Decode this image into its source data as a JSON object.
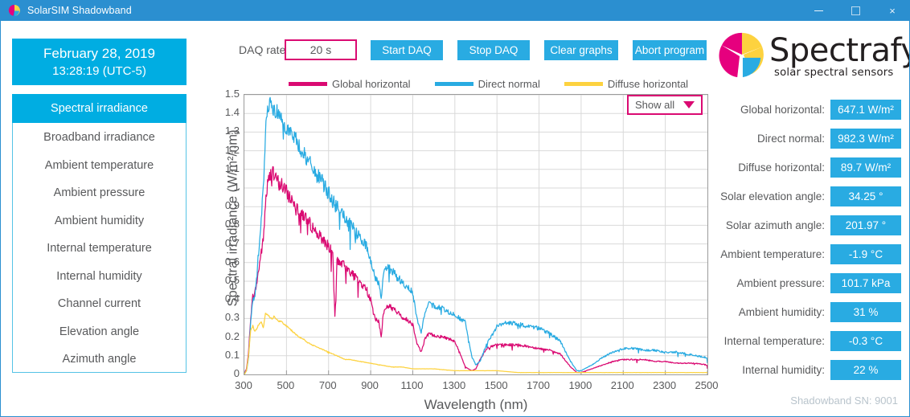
{
  "window": {
    "title": "SolarSIM Shadowband",
    "icon": "app-logo-icon",
    "minimize": "minimize-icon",
    "maximize": "maximize-icon",
    "close": "×"
  },
  "sidebar": {
    "datetime": {
      "date": "February 28, 2019",
      "time": "13:28:19 (UTC-5)"
    },
    "items": [
      {
        "label": "Spectral irradiance",
        "active": true
      },
      {
        "label": "Broadband irradiance",
        "active": false
      },
      {
        "label": "Ambient temperature",
        "active": false
      },
      {
        "label": "Ambient pressure",
        "active": false
      },
      {
        "label": "Ambient humidity",
        "active": false
      },
      {
        "label": "Internal temperature",
        "active": false
      },
      {
        "label": "Internal humidity",
        "active": false
      },
      {
        "label": "Channel current",
        "active": false
      },
      {
        "label": "Elevation angle",
        "active": false
      },
      {
        "label": "Azimuth angle",
        "active": false
      }
    ]
  },
  "toolbar": {
    "daq_rate_label": "DAQ rate:",
    "daq_rate_value": "20 s",
    "start_label": "Start DAQ",
    "stop_label": "Stop DAQ",
    "clear_label": "Clear graphs",
    "abort_label": "Abort program"
  },
  "brand": {
    "name": "Spectrafy",
    "tagline": "solar spectral sensors"
  },
  "graph_filter": {
    "selected": "Show all"
  },
  "readouts": [
    {
      "label": "Global horizontal:",
      "value": "647.1 W/m²"
    },
    {
      "label": "Direct normal:",
      "value": "982.3 W/m²"
    },
    {
      "label": "Diffuse horizontal:",
      "value": "89.7 W/m²"
    },
    {
      "label": "Solar elevation angle:",
      "value": "34.25 °"
    },
    {
      "label": "Solar azimuth angle:",
      "value": "201.97 °"
    },
    {
      "label": "Ambient temperature:",
      "value": "-1.9 °C"
    },
    {
      "label": "Ambient pressure:",
      "value": "101.7 kPa"
    },
    {
      "label": "Ambient humidity:",
      "value": "31 %"
    },
    {
      "label": "Internal temperature:",
      "value": "-0.3 °C"
    },
    {
      "label": "Internal humidity:",
      "value": "22 %"
    }
  ],
  "status": {
    "serial": "Shadowband SN: 9001"
  },
  "colors": {
    "accent_blue": "#29abe2",
    "header_blue": "#2b8fd0",
    "panel_cyan": "#00ade2",
    "magenta": "#da0a72",
    "yellow": "#fdd23f",
    "text_gray": "#58595b"
  },
  "chart_data": {
    "type": "line",
    "title": "",
    "xlabel": "Wavelength (nm)",
    "ylabel": "Spectral irradiance (W/m²/nm)",
    "xlim": [
      300,
      2500
    ],
    "ylim": [
      0,
      1.5
    ],
    "xticks": [
      300,
      500,
      700,
      900,
      1100,
      1300,
      1500,
      1700,
      1900,
      2100,
      2300,
      2500
    ],
    "yticks": [
      0,
      0.1,
      0.2,
      0.3,
      0.4,
      0.5,
      0.6,
      0.7,
      0.8,
      0.9,
      1,
      1.1,
      1.2,
      1.3,
      1.4,
      1.5
    ],
    "grid": true,
    "legend_position": "above-plot",
    "series": [
      {
        "name": "Global horizontal",
        "color": "#da0a72",
        "x": [
          300,
          310,
          320,
          330,
          340,
          350,
          360,
          370,
          380,
          390,
          400,
          410,
          420,
          430,
          440,
          450,
          460,
          470,
          480,
          500,
          520,
          540,
          560,
          580,
          600,
          620,
          640,
          660,
          680,
          700,
          720,
          730,
          740,
          760,
          780,
          800,
          820,
          840,
          860,
          880,
          900,
          920,
          940,
          950,
          960,
          980,
          1000,
          1020,
          1040,
          1060,
          1080,
          1100,
          1120,
          1140,
          1160,
          1180,
          1200,
          1250,
          1300,
          1350,
          1380,
          1400,
          1420,
          1450,
          1500,
          1550,
          1600,
          1650,
          1700,
          1750,
          1800,
          1850,
          1880,
          1900,
          1950,
          2000,
          2050,
          2100,
          2150,
          2200,
          2250,
          2300,
          2350,
          2400,
          2450,
          2500
        ],
        "y": [
          0.0,
          0.03,
          0.12,
          0.31,
          0.42,
          0.44,
          0.5,
          0.58,
          0.66,
          0.72,
          0.92,
          1.02,
          1.06,
          1.1,
          1.07,
          1.05,
          1.04,
          1.02,
          1.02,
          0.98,
          0.95,
          0.92,
          0.89,
          0.86,
          0.83,
          0.8,
          0.77,
          0.74,
          0.72,
          0.69,
          0.65,
          0.3,
          0.62,
          0.6,
          0.58,
          0.56,
          0.53,
          0.51,
          0.48,
          0.46,
          0.4,
          0.3,
          0.28,
          0.2,
          0.33,
          0.37,
          0.36,
          0.34,
          0.32,
          0.3,
          0.29,
          0.27,
          0.17,
          0.12,
          0.2,
          0.22,
          0.21,
          0.2,
          0.18,
          0.04,
          0.02,
          0.03,
          0.08,
          0.14,
          0.16,
          0.16,
          0.16,
          0.15,
          0.14,
          0.13,
          0.11,
          0.04,
          0.01,
          0.01,
          0.03,
          0.05,
          0.07,
          0.08,
          0.08,
          0.08,
          0.07,
          0.07,
          0.06,
          0.06,
          0.06,
          0.05,
          0.04,
          0.03
        ]
      },
      {
        "name": "Direct normal",
        "color": "#29abe2",
        "x": [
          300,
          310,
          320,
          330,
          340,
          350,
          360,
          370,
          380,
          390,
          400,
          410,
          420,
          430,
          440,
          450,
          460,
          470,
          480,
          500,
          520,
          540,
          560,
          580,
          600,
          620,
          640,
          660,
          680,
          700,
          720,
          740,
          760,
          780,
          800,
          820,
          840,
          860,
          880,
          900,
          920,
          940,
          950,
          960,
          980,
          1000,
          1020,
          1040,
          1060,
          1080,
          1100,
          1120,
          1140,
          1160,
          1180,
          1200,
          1250,
          1300,
          1350,
          1380,
          1400,
          1420,
          1450,
          1500,
          1550,
          1600,
          1650,
          1700,
          1750,
          1800,
          1850,
          1880,
          1900,
          1950,
          2000,
          2050,
          2100,
          2150,
          2200,
          2250,
          2300,
          2350,
          2400,
          2450,
          2500
        ],
        "y": [
          0.0,
          0.02,
          0.09,
          0.28,
          0.4,
          0.42,
          0.55,
          0.7,
          0.85,
          1.0,
          1.3,
          1.42,
          1.46,
          1.44,
          1.43,
          1.41,
          1.42,
          1.4,
          1.38,
          1.33,
          1.3,
          1.27,
          1.23,
          1.19,
          1.15,
          1.12,
          1.08,
          1.05,
          1.02,
          0.98,
          0.93,
          0.9,
          0.87,
          0.84,
          0.81,
          0.78,
          0.75,
          0.72,
          0.69,
          0.62,
          0.52,
          0.49,
          0.4,
          0.55,
          0.58,
          0.56,
          0.53,
          0.51,
          0.48,
          0.46,
          0.44,
          0.3,
          0.22,
          0.35,
          0.38,
          0.37,
          0.35,
          0.32,
          0.28,
          0.1,
          0.05,
          0.07,
          0.16,
          0.26,
          0.28,
          0.27,
          0.26,
          0.25,
          0.22,
          0.18,
          0.07,
          0.02,
          0.02,
          0.05,
          0.09,
          0.12,
          0.14,
          0.14,
          0.13,
          0.13,
          0.12,
          0.12,
          0.11,
          0.1,
          0.09,
          0.06
        ]
      },
      {
        "name": "Diffuse horizontal",
        "color": "#fdd23f",
        "x": [
          300,
          310,
          320,
          330,
          340,
          350,
          360,
          370,
          380,
          390,
          400,
          410,
          420,
          430,
          440,
          450,
          460,
          480,
          500,
          520,
          540,
          560,
          580,
          600,
          620,
          640,
          660,
          680,
          700,
          720,
          740,
          760,
          780,
          800,
          850,
          900,
          950,
          1000,
          1050,
          1100,
          1150,
          1200,
          1300,
          1400,
          1500,
          1600,
          1700,
          1800,
          1900,
          2000,
          2100,
          2200,
          2300,
          2400,
          2500
        ],
        "y": [
          0.0,
          0.02,
          0.1,
          0.24,
          0.26,
          0.23,
          0.25,
          0.27,
          0.28,
          0.25,
          0.33,
          0.32,
          0.31,
          0.3,
          0.31,
          0.3,
          0.29,
          0.28,
          0.26,
          0.24,
          0.22,
          0.2,
          0.19,
          0.17,
          0.16,
          0.15,
          0.14,
          0.13,
          0.12,
          0.11,
          0.1,
          0.09,
          0.08,
          0.08,
          0.07,
          0.06,
          0.05,
          0.04,
          0.04,
          0.03,
          0.03,
          0.03,
          0.02,
          0.02,
          0.02,
          0.01,
          0.01,
          0.01,
          0.01,
          0.01,
          0.01,
          0.01,
          0.01,
          0.01,
          0.01
        ]
      }
    ]
  }
}
